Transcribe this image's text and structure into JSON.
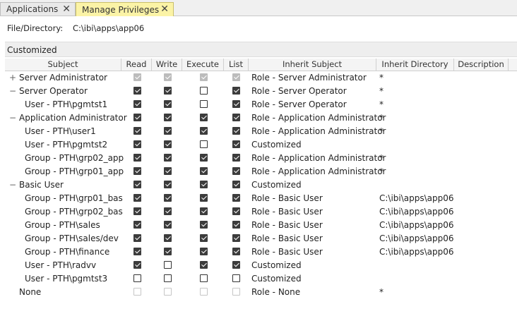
{
  "tabs": [
    {
      "label": "Applications",
      "active": false
    },
    {
      "label": "Manage Privileges",
      "active": true
    }
  ],
  "file_directory_label": "File/Directory:",
  "file_directory_value": "C:\\ibi\\apps\\app06",
  "section_title": "Customized",
  "columns": [
    "Subject",
    "Read",
    "Write",
    "Execute",
    "List",
    "Inherit Subject",
    "Inherit Directory",
    "Description"
  ],
  "rows": [
    {
      "subject": "Server Administrator",
      "level": 0,
      "expander": "+",
      "read": true,
      "write": true,
      "execute": true,
      "list": true,
      "disabled": true,
      "inherit_subject": "Role - Server Administrator",
      "inherit_directory": "*"
    },
    {
      "subject": "Server Operator",
      "level": 0,
      "expander": "−",
      "read": true,
      "write": true,
      "execute": false,
      "list": true,
      "disabled": false,
      "inherit_subject": "Role - Server Operator",
      "inherit_directory": "*"
    },
    {
      "subject": "User - PTH\\pgmtst1",
      "level": 1,
      "expander": "",
      "read": true,
      "write": true,
      "execute": false,
      "list": true,
      "disabled": false,
      "inherit_subject": "Role - Server Operator",
      "inherit_directory": "*"
    },
    {
      "subject": "Application Administrator",
      "level": 0,
      "expander": "−",
      "read": true,
      "write": true,
      "execute": true,
      "list": true,
      "disabled": false,
      "inherit_subject": "Role - Application Administrator",
      "inherit_directory": "*"
    },
    {
      "subject": "User - PTH\\user1",
      "level": 1,
      "expander": "",
      "read": true,
      "write": true,
      "execute": true,
      "list": true,
      "disabled": false,
      "inherit_subject": "Role - Application Administrator",
      "inherit_directory": "*"
    },
    {
      "subject": "User - PTH\\pgmtst2",
      "level": 1,
      "expander": "",
      "read": true,
      "write": true,
      "execute": false,
      "list": true,
      "disabled": false,
      "inherit_subject": "Customized",
      "inherit_directory": ""
    },
    {
      "subject": "Group - PTH\\grp02_app",
      "level": 1,
      "expander": "",
      "read": true,
      "write": true,
      "execute": true,
      "list": true,
      "disabled": false,
      "inherit_subject": "Role - Application Administrator",
      "inherit_directory": "*"
    },
    {
      "subject": "Group - PTH\\grp01_app",
      "level": 1,
      "expander": "",
      "read": true,
      "write": true,
      "execute": true,
      "list": true,
      "disabled": false,
      "inherit_subject": "Role - Application Administrator",
      "inherit_directory": "*"
    },
    {
      "subject": "Basic User",
      "level": 0,
      "expander": "−",
      "read": true,
      "write": true,
      "execute": true,
      "list": true,
      "disabled": false,
      "inherit_subject": "Customized",
      "inherit_directory": ""
    },
    {
      "subject": "Group - PTH\\grp01_bas",
      "level": 1,
      "expander": "",
      "read": true,
      "write": true,
      "execute": true,
      "list": true,
      "disabled": false,
      "inherit_subject": "Role - Basic User",
      "inherit_directory": "C:\\ibi\\apps\\app06"
    },
    {
      "subject": "Group - PTH\\grp02_bas",
      "level": 1,
      "expander": "",
      "read": true,
      "write": true,
      "execute": true,
      "list": true,
      "disabled": false,
      "inherit_subject": "Role - Basic User",
      "inherit_directory": "C:\\ibi\\apps\\app06"
    },
    {
      "subject": "Group - PTH\\sales",
      "level": 1,
      "expander": "",
      "read": true,
      "write": true,
      "execute": true,
      "list": true,
      "disabled": false,
      "inherit_subject": "Role - Basic User",
      "inherit_directory": "C:\\ibi\\apps\\app06"
    },
    {
      "subject": "Group - PTH\\sales/dev",
      "level": 1,
      "expander": "",
      "read": true,
      "write": true,
      "execute": true,
      "list": true,
      "disabled": false,
      "inherit_subject": "Role - Basic User",
      "inherit_directory": "C:\\ibi\\apps\\app06"
    },
    {
      "subject": "Group - PTH\\finance",
      "level": 1,
      "expander": "",
      "read": true,
      "write": true,
      "execute": true,
      "list": true,
      "disabled": false,
      "inherit_subject": "Role - Basic User",
      "inherit_directory": "C:\\ibi\\apps\\app06"
    },
    {
      "subject": "User - PTH\\radvv",
      "level": 1,
      "expander": "",
      "read": true,
      "write": false,
      "execute": true,
      "list": true,
      "disabled": false,
      "inherit_subject": "Customized",
      "inherit_directory": ""
    },
    {
      "subject": "User - PTH\\pgmtst3",
      "level": 1,
      "expander": "",
      "read": false,
      "write": false,
      "execute": false,
      "list": false,
      "disabled": false,
      "inherit_subject": "Customized",
      "inherit_directory": ""
    },
    {
      "subject": "None",
      "level": 0,
      "expander": "",
      "read": false,
      "write": false,
      "execute": false,
      "list": false,
      "disabled": true,
      "inherit_subject": "Role - None",
      "inherit_directory": "*"
    }
  ]
}
